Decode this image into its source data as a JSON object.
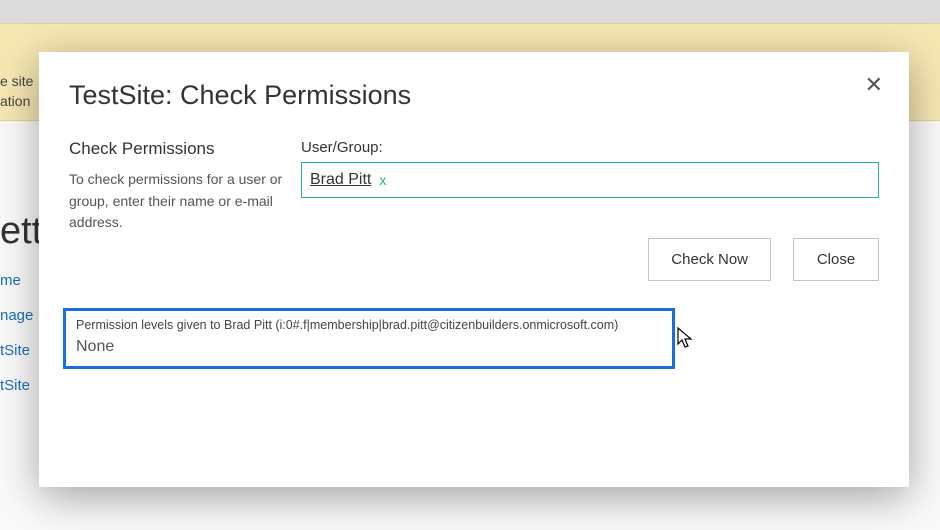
{
  "banner": {
    "line1": "e site",
    "line2": "ation"
  },
  "page": {
    "title_fragment": "ett",
    "nav": [
      "me",
      "nage",
      "tSite",
      "tSite"
    ]
  },
  "modal": {
    "title": "TestSite: Check Permissions",
    "close_label": "✕",
    "section_heading": "Check Permissions",
    "section_desc": "To check permissions for a user or group, enter their name or e-mail address.",
    "field_label": "User/Group:",
    "picked_user": "Brad Pitt",
    "picked_remove": "x",
    "input_value": "",
    "check_now": "Check Now",
    "close": "Close",
    "results_header": "Permission levels given to Brad Pitt (i:0#.f|membership|brad.pitt@citizenbuilders.onmicrosoft.com)",
    "results_value": "None"
  }
}
